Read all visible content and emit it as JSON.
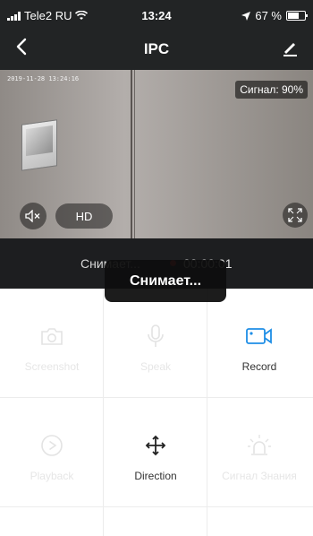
{
  "status_bar": {
    "carrier": "Tele2 RU",
    "time": "13:24",
    "battery": "67 %"
  },
  "header": {
    "back_icon": "chevron-left-icon",
    "title": "IPC",
    "edit_icon": "pencil-icon"
  },
  "video": {
    "timestamp": "2019-11-28 13:24:16",
    "signal_label": "Сигнал: 90%",
    "hd_label": "HD",
    "mute_icon": "speaker-mute-icon",
    "fullscreen_icon": "expand-icon"
  },
  "recording": {
    "status_text": "Снимает...",
    "timer": "00:00:01"
  },
  "toast": {
    "text": "Снимает..."
  },
  "controls": [
    {
      "label": "Screenshot",
      "icon": "camera-icon",
      "enabled": false
    },
    {
      "label": "Speak",
      "icon": "microphone-icon",
      "enabled": false
    },
    {
      "label": "Record",
      "icon": "video-camera-icon",
      "enabled": true
    },
    {
      "label": "Playback",
      "icon": "play-circle-icon",
      "enabled": false
    },
    {
      "label": "Direction",
      "icon": "move-arrows-icon",
      "enabled": true
    },
    {
      "label": "Сигнал Знания",
      "icon": "alarm-light-icon",
      "enabled": false
    }
  ],
  "colors": {
    "accent": "#1e8ee6",
    "header_bg": "#222425",
    "record_dot": "#e02a2a"
  }
}
